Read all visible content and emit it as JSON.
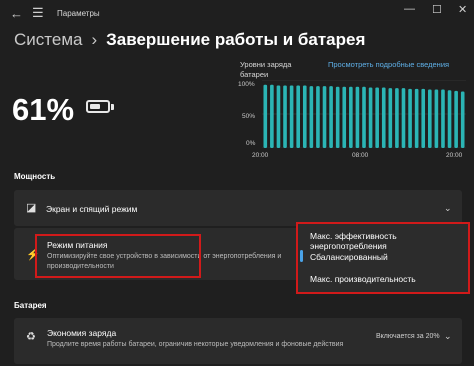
{
  "titlebar": {
    "title": "Параметры",
    "back_icon": "back-arrow-icon",
    "menu_icon": "hamburger-icon"
  },
  "breadcrumb": {
    "parent": "Система",
    "separator": "›",
    "current": "Завершение работы и батарея"
  },
  "battery": {
    "percent": "61%",
    "charge_level": 0.61
  },
  "history": {
    "label": "Уровни заряда батареи",
    "link": "Просмотреть подробные сведения",
    "y_ticks": [
      "100%",
      "50%",
      "0%"
    ],
    "x_ticks": [
      "20:00",
      "08:00",
      "20:00"
    ]
  },
  "chart_data": {
    "type": "bar",
    "title": "Уровни заряда батареи",
    "ylim": [
      0,
      100
    ],
    "y_ticks": [
      "100%",
      "50%",
      "0%"
    ],
    "x_ticks": [
      "20:00",
      "08:00",
      "20:00"
    ],
    "values": [
      93,
      93,
      92,
      92,
      92,
      92,
      92,
      91,
      91,
      91,
      91,
      90,
      90,
      90,
      90,
      90,
      89,
      89,
      89,
      88,
      88,
      88,
      87,
      87,
      87,
      86,
      86,
      86,
      85,
      84,
      83
    ]
  },
  "sections": {
    "power": "Мощность",
    "battery": "Батарея"
  },
  "screen_sleep": {
    "label": "Экран и спящий режим"
  },
  "power_mode": {
    "title": "Режим питания",
    "description": "Оптимизируйте свое устройство в зависимости от энергопотребления и производительности",
    "options": [
      "Макс. эффективность энергопотребления",
      "Сбалансированный",
      "Макс. производительность"
    ],
    "selected": "Сбалансированный"
  },
  "battery_saver": {
    "title": "Экономия заряда",
    "description": "Продлите время работы батареи, ограничив некоторые уведомления и фоновые действия",
    "value": "Включается за 20%"
  },
  "colors": {
    "accent": "#4aa3e8",
    "bars": "#2bb5b5",
    "highlight": "#d11a1a"
  }
}
